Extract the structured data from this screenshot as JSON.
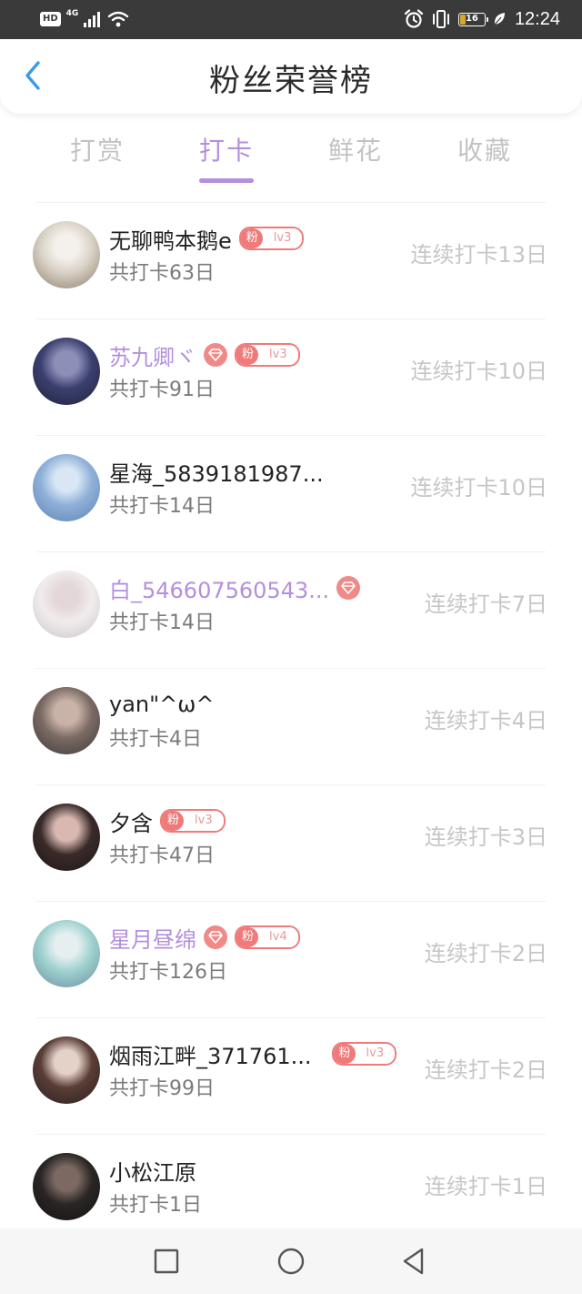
{
  "status_bar": {
    "hd": "HD",
    "network": "4G",
    "battery": "16",
    "time": "12:24"
  },
  "header": {
    "title": "粉丝荣誉榜",
    "back_icon": "chevron-left-icon"
  },
  "tabs": [
    {
      "label": "打赏",
      "active": false
    },
    {
      "label": "打卡",
      "active": true
    },
    {
      "label": "鲜花",
      "active": false
    },
    {
      "label": "收藏",
      "active": false
    }
  ],
  "badge": {
    "fan_char": "粉"
  },
  "rows": [
    {
      "name": "无聊鸭本鹅e",
      "vip": false,
      "gem": false,
      "fan_level": "lv3",
      "total": "共打卡63日",
      "streak": "连续打卡13日",
      "avatar_colors": [
        "#d9d2c6",
        "#f4f1ec",
        "#8b7d6b"
      ]
    },
    {
      "name": "苏九卿ヾ",
      "vip": true,
      "gem": true,
      "fan_level": "lv3",
      "total": "共打卡91日",
      "streak": "连续打卡10日",
      "avatar_colors": [
        "#3b3f6e",
        "#8d8fb8",
        "#202238"
      ]
    },
    {
      "name": "星海_5839181987...",
      "vip": false,
      "gem": false,
      "fan_level": "",
      "total": "共打卡14日",
      "streak": "连续打卡10日",
      "avatar_colors": [
        "#8fb0d8",
        "#d8e6f5",
        "#5c82b5"
      ]
    },
    {
      "name": "白_546607560543...",
      "vip": true,
      "gem": true,
      "fan_level": "",
      "total": "共打卡14日",
      "streak": "连续打卡7日",
      "avatar_colors": [
        "#f1ecec",
        "#e3d7d9",
        "#c9c4cc"
      ]
    },
    {
      "name": "yan\"^ω^",
      "vip": false,
      "gem": false,
      "fan_level": "",
      "total": "共打卡4日",
      "streak": "连续打卡4日",
      "avatar_colors": [
        "#7a6a63",
        "#c9b2a8",
        "#3f3a3a"
      ]
    },
    {
      "name": "夕含",
      "vip": false,
      "gem": false,
      "fan_level": "lv3",
      "total": "共打卡47日",
      "streak": "连续打卡3日",
      "avatar_colors": [
        "#3a2b2a",
        "#d8b8b0",
        "#1e1616"
      ]
    },
    {
      "name": "星月昼绵",
      "vip": true,
      "gem": true,
      "fan_level": "lv4",
      "total": "共打卡126日",
      "streak": "连续打卡2日",
      "avatar_colors": [
        "#9fd2cf",
        "#e6eef0",
        "#6a8ca0"
      ]
    },
    {
      "name": "烟雨江畔_371761...",
      "vip": false,
      "gem": false,
      "fan_level": "lv3",
      "total": "共打卡99日",
      "streak": "连续打卡2日",
      "avatar_colors": [
        "#5a3e36",
        "#e4d2c8",
        "#2a1e1e"
      ]
    },
    {
      "name": "小松江原",
      "vip": false,
      "gem": false,
      "fan_level": "",
      "total": "共打卡1日",
      "streak": "连续打卡1日",
      "avatar_colors": [
        "#2b2626",
        "#7c6a62",
        "#141010"
      ]
    }
  ],
  "nav_bar": {
    "icons": [
      "square-icon",
      "circle-icon",
      "triangle-back-icon"
    ]
  }
}
